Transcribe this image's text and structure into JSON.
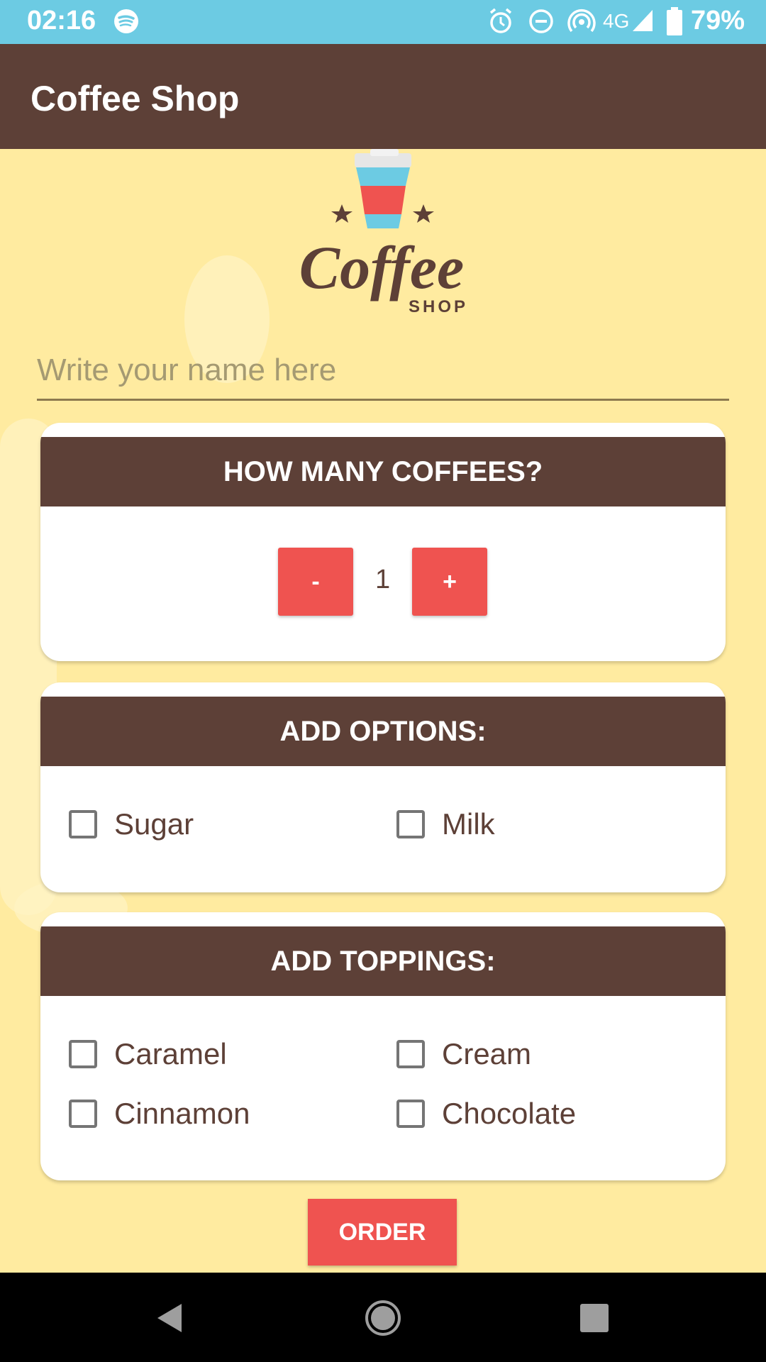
{
  "status_bar": {
    "time": "02:16",
    "network": "4G",
    "battery": "79%"
  },
  "app_bar": {
    "title": "Coffee Shop"
  },
  "name_input": {
    "placeholder": "Write your name here",
    "value": ""
  },
  "quantity_card": {
    "title": "HOW MANY COFFEES?",
    "decrement_label": "-",
    "increment_label": "+",
    "quantity": "1"
  },
  "options_card": {
    "title": "ADD OPTIONS:",
    "items": [
      {
        "label": "Sugar",
        "checked": false
      },
      {
        "label": "Milk",
        "checked": false
      }
    ]
  },
  "toppings_card": {
    "title": "ADD TOPPINGS:",
    "items": [
      {
        "label": "Caramel",
        "checked": false
      },
      {
        "label": "Cream",
        "checked": false
      },
      {
        "label": "Cinnamon",
        "checked": false
      },
      {
        "label": "Chocolate",
        "checked": false
      }
    ]
  },
  "order_button": {
    "label": "ORDER"
  },
  "logo": {
    "script_text": "Coffee",
    "sub_text": "SHOP"
  },
  "colors": {
    "status_bar": "#6ccbe3",
    "app_bar": "#5d4037",
    "background": "#ffeba0",
    "accent": "#ef5350"
  }
}
